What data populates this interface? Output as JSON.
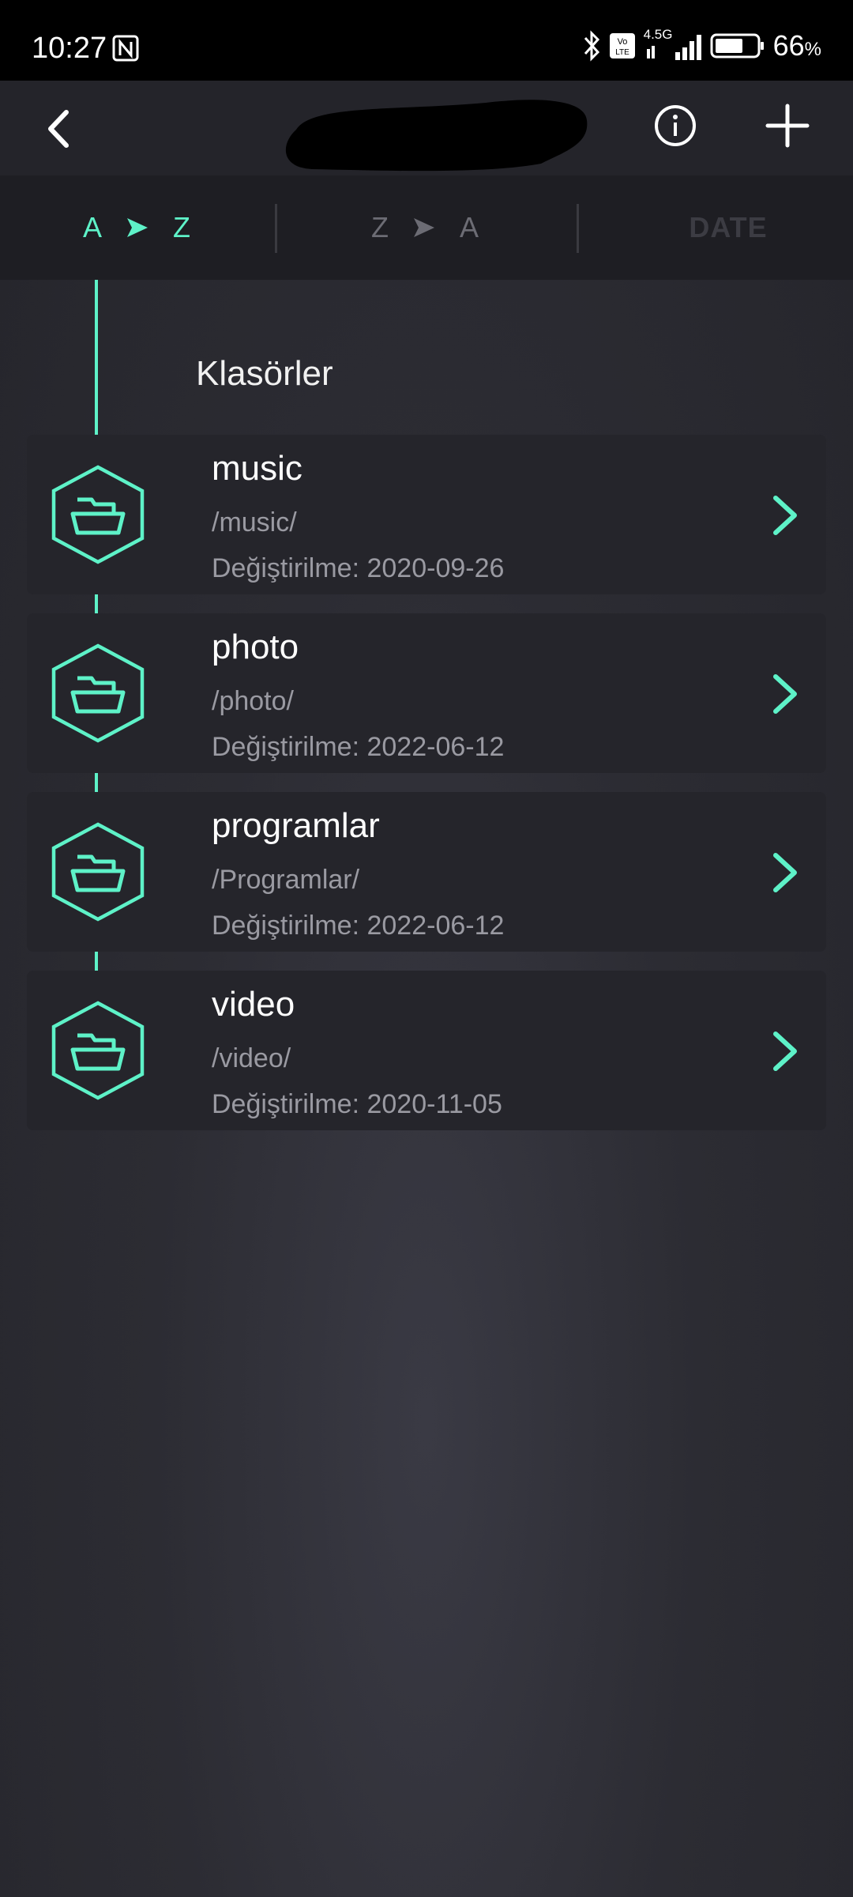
{
  "status_bar": {
    "time": "10:27",
    "network": "4.5G",
    "battery_percent": "66",
    "battery_unit": "%",
    "icons": [
      "nfc-icon",
      "bluetooth-icon",
      "volte-icon",
      "signal-icon",
      "battery-icon"
    ]
  },
  "app_bar": {
    "icons": [
      "back-arrow-icon",
      "info-icon",
      "plus-icon"
    ]
  },
  "sort": {
    "az": {
      "from": "A",
      "to": "Z"
    },
    "za": {
      "from": "Z",
      "to": "A"
    },
    "date": "DATE",
    "active": "az"
  },
  "section_title": "Klasörler",
  "folders": [
    {
      "name": "music",
      "path": "/music/",
      "modified": "Değiştirilme: 2020-09-26"
    },
    {
      "name": "photo",
      "path": "/photo/",
      "modified": "Değiştirilme: 2022-06-12"
    },
    {
      "name": "programlar",
      "path": "/Programlar/",
      "modified": "Değiştirilme: 2022-06-12"
    },
    {
      "name": "video",
      "path": "/video/",
      "modified": "Değiştirilme: 2020-11-05"
    }
  ],
  "colors": {
    "accent": "#5ef2c8",
    "background": "#2c2c33",
    "card": "#25252b",
    "status_bar": "#000000",
    "muted_text": "#9a9aa2"
  }
}
